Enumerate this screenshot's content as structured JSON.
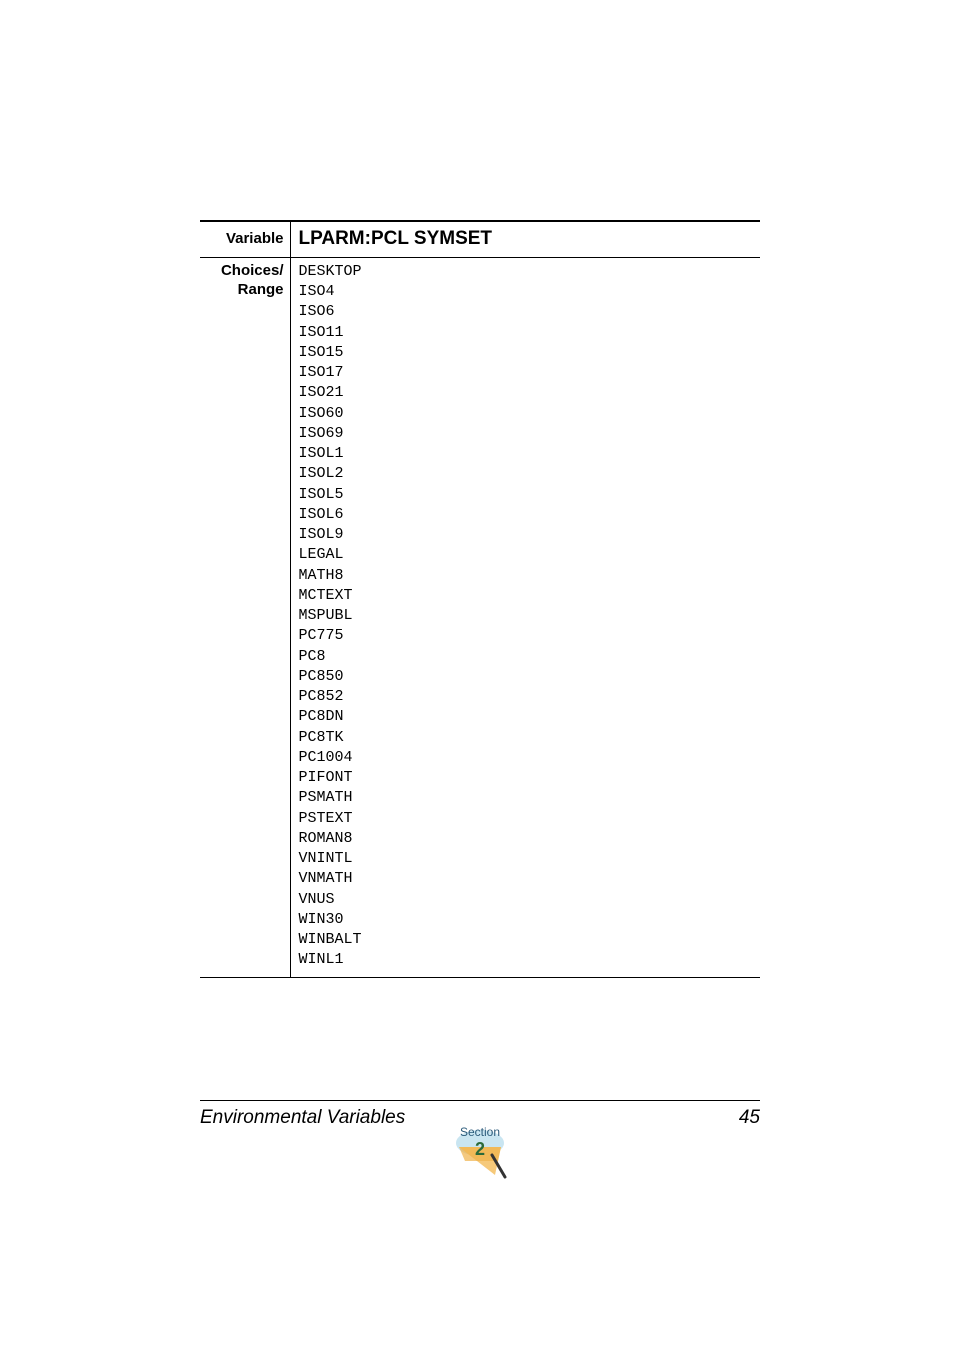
{
  "table": {
    "variable_label": "Variable",
    "variable_value": "LPARM:PCL SYMSET",
    "choices_label_line1": "Choices/",
    "choices_label_line2": "Range",
    "choices": [
      "DESKTOP",
      "ISO4",
      "ISO6",
      "ISO11",
      "ISO15",
      "ISO17",
      "ISO21",
      "ISO60",
      "ISO69",
      "ISOL1",
      "ISOL2",
      "ISOL5",
      "ISOL6",
      "ISOL9",
      "LEGAL",
      "MATH8",
      "MCTEXT",
      "MSPUBL",
      "PC775",
      "PC8",
      "PC850",
      "PC852",
      "PC8DN",
      "PC8TK",
      "PC1004",
      "PIFONT",
      "PSMATH",
      "PSTEXT",
      "ROMAN8",
      "VNINTL",
      "VNMATH",
      "VNUS",
      "WIN30",
      "WINBALT",
      "WINL1"
    ]
  },
  "footer": {
    "title": "Environmental Variables",
    "page": "45",
    "section_label": "Section",
    "section_number": "2"
  }
}
